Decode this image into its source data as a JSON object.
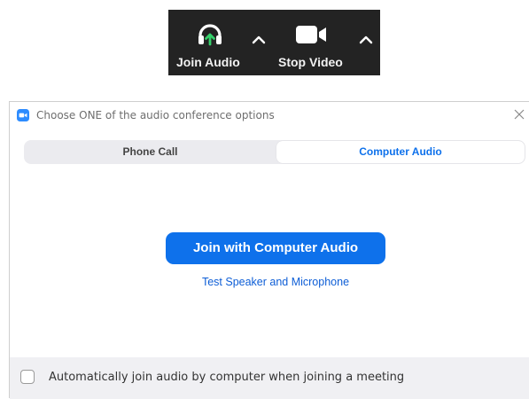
{
  "toolbar": {
    "join_audio": {
      "label": "Join Audio",
      "icon": "headphones-icon",
      "icon_accent": "#35d06a"
    },
    "stop_video": {
      "label": "Stop Video",
      "icon": "video-camera-icon"
    },
    "caret_icon": "chevron-up-icon",
    "background": "#232323"
  },
  "dialog": {
    "title": "Choose ONE of the audio conference options",
    "app_icon": "zoom-logo-icon",
    "close_icon": "close-icon",
    "tabs": [
      {
        "label": "Phone Call",
        "selected": false
      },
      {
        "label": "Computer Audio",
        "selected": true
      }
    ],
    "join_button_label": "Join with Computer Audio",
    "test_link_label": "Test Speaker and Microphone",
    "auto_join": {
      "label": "Automatically join audio by computer when joining a meeting",
      "checked": false
    }
  },
  "colors": {
    "accent": "#0e71eb",
    "link": "#0e5ed6"
  }
}
